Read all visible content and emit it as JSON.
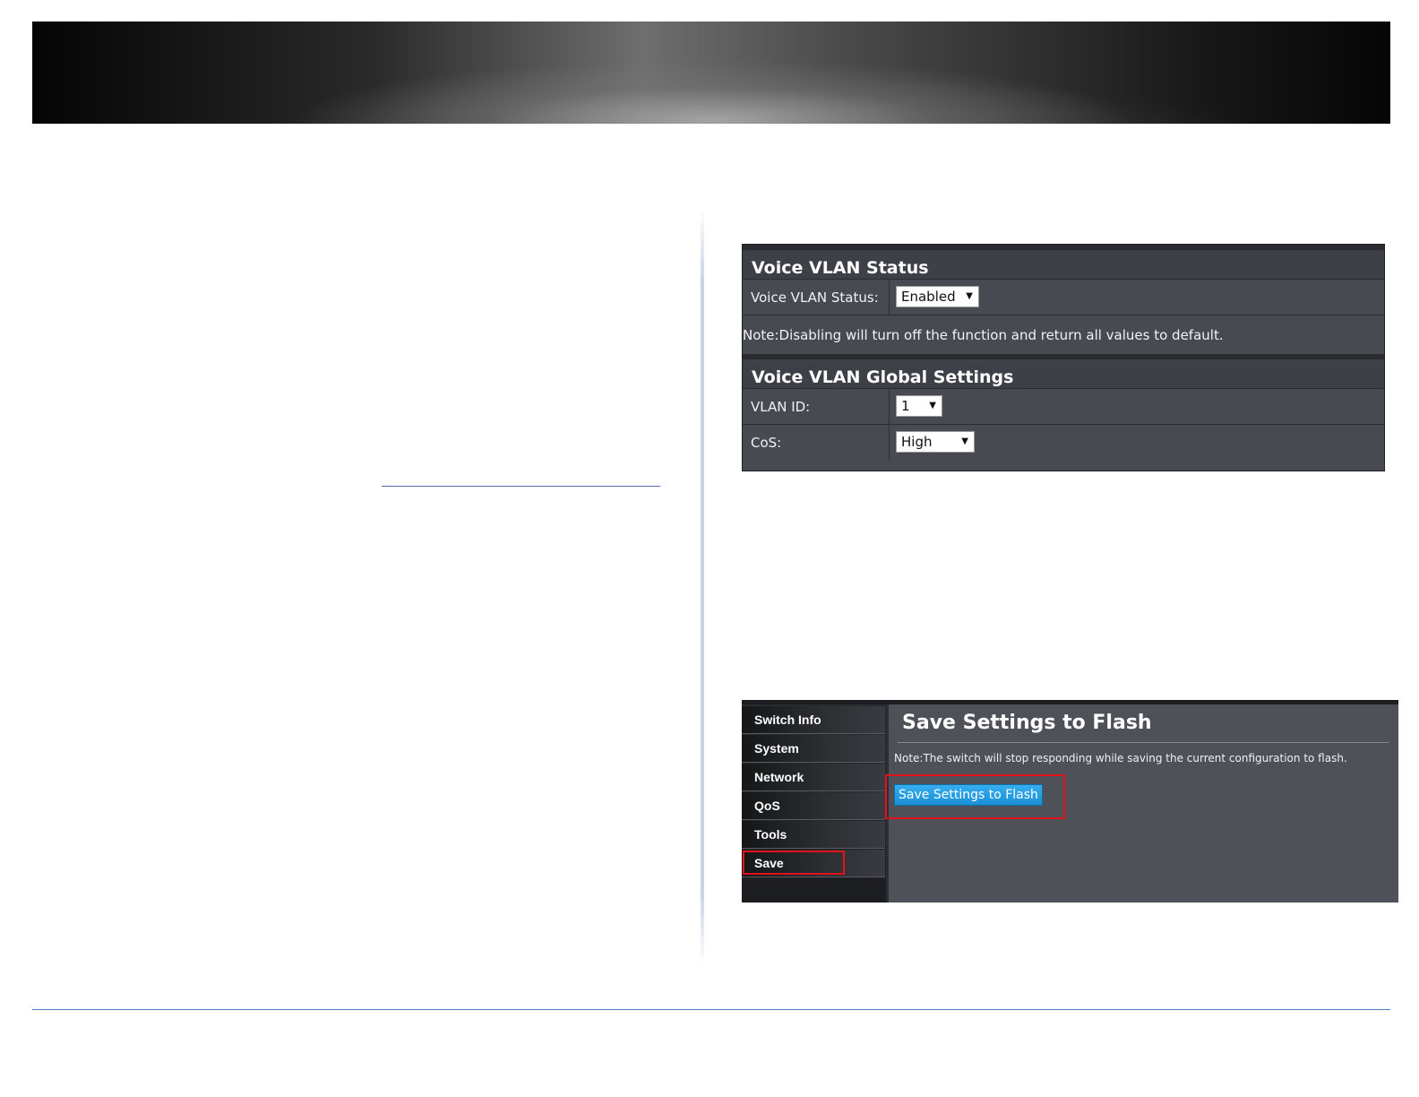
{
  "vlan_panel": {
    "status_section_title": "Voice VLAN Status",
    "status_label": "Voice VLAN Status:",
    "status_value": "Enabled",
    "note": "Note:Disabling will turn off the function and return all values to default.",
    "global_section_title": "Voice VLAN Global Settings",
    "vlan_id_label": "VLAN ID:",
    "vlan_id_value": "1",
    "cos_label": "CoS:",
    "cos_value": "High"
  },
  "save_panel": {
    "sidebar_items": [
      {
        "label": "Switch Info"
      },
      {
        "label": "System"
      },
      {
        "label": "Network"
      },
      {
        "label": "QoS"
      },
      {
        "label": "Tools"
      },
      {
        "label": "Save"
      }
    ],
    "title": "Save Settings to Flash",
    "note": "Note:The switch will stop responding while saving the current configuration to flash.",
    "button_label": "Save Settings to Flash"
  },
  "colors": {
    "highlight_box": "#e3101d",
    "button_blue": "#1a8fd6",
    "panel_bg": "#484a51",
    "footer_rule": "#4a7fc0"
  },
  "icons": {
    "dropdown": "caret-down-icon"
  }
}
